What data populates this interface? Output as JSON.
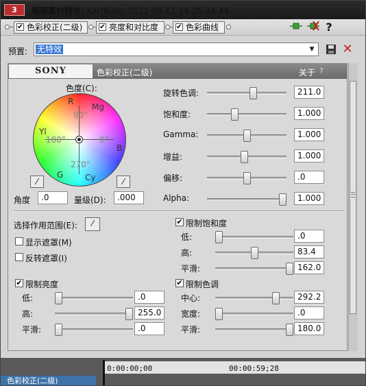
{
  "window": {
    "badge": "3",
    "title_prefix": "视频素材特效:",
    "title_rest": " KartRider 2011-09-11 14-26-34-44"
  },
  "chain": {
    "items": [
      {
        "label": "色彩校正(二级)",
        "checked": true
      },
      {
        "label": "亮度和对比度",
        "checked": true
      },
      {
        "label": "色彩曲线",
        "checked": true
      }
    ],
    "help_icon": "?"
  },
  "preset": {
    "label": "预置:",
    "value": "无特效"
  },
  "plugin": {
    "brand": "SONY",
    "name": "色彩校正(二级)",
    "about": "关于",
    "help": "?"
  },
  "color_wheel": {
    "title": "色度(C):",
    "hues": {
      "r": "R",
      "mg": "Mg",
      "yl": "Yl",
      "b": "B",
      "g": "G",
      "cy": "Cy"
    },
    "degrees": {
      "d90": "90°",
      "d180": "180°",
      "d0": "0°",
      "d270": "270°"
    },
    "angle_label": "角度",
    "angle_value": ".0",
    "magnitude_label": "量级(D):",
    "magnitude_value": ".000"
  },
  "adjustments": [
    {
      "label": "旋转色调:",
      "value": "211.0",
      "level": 0.59
    },
    {
      "label": "饱和度:",
      "value": "1.000",
      "level": 0.33
    },
    {
      "label": "Gamma:",
      "value": "1.000",
      "level": 0.5
    },
    {
      "label": "增益:",
      "value": "1.000",
      "level": 0.47
    },
    {
      "label": "偏移:",
      "value": ".0",
      "level": 0.5
    },
    {
      "label": "Alpha:",
      "value": "1.000",
      "level": 1.0
    }
  ],
  "mask": {
    "select_range_label": "选择作用范围(E):",
    "show_mask_label": "显示遮罩(M)",
    "show_mask_checked": false,
    "invert_mask_label": "反转遮罩(I)",
    "invert_mask_checked": false
  },
  "limit_saturation": {
    "label": "限制饱和度",
    "checked": true,
    "rows": [
      {
        "label": "低:",
        "value": ".0",
        "level": 0.0
      },
      {
        "label": "高:",
        "value": "83.4",
        "level": 0.5
      },
      {
        "label": "平滑:",
        "value": "162.0",
        "level": 1.0
      }
    ]
  },
  "limit_luminance": {
    "label": "限制亮度",
    "checked": true,
    "rows": [
      {
        "label": "低:",
        "value": ".0",
        "level": 0.0
      },
      {
        "label": "高:",
        "value": "255.0",
        "level": 1.0
      },
      {
        "label": "平滑:",
        "value": ".0",
        "level": 0.0
      }
    ]
  },
  "limit_hue": {
    "label": "限制色调",
    "checked": true,
    "rows": [
      {
        "label": "中心:",
        "value": "292.2",
        "level": 0.81
      },
      {
        "label": "宽度:",
        "value": ".0",
        "level": 0.0
      },
      {
        "label": "平滑:",
        "value": "180.0",
        "level": 1.0
      }
    ]
  },
  "timeline": {
    "start_time": "0:00:00;00",
    "end_time": "00:00:59;28",
    "track_label": "色彩校正(二级)"
  },
  "colors": {
    "badge": "#b82e2e",
    "header": "#6f6f6f",
    "selection": "#3a78d6",
    "delete": "#c81d1d"
  }
}
